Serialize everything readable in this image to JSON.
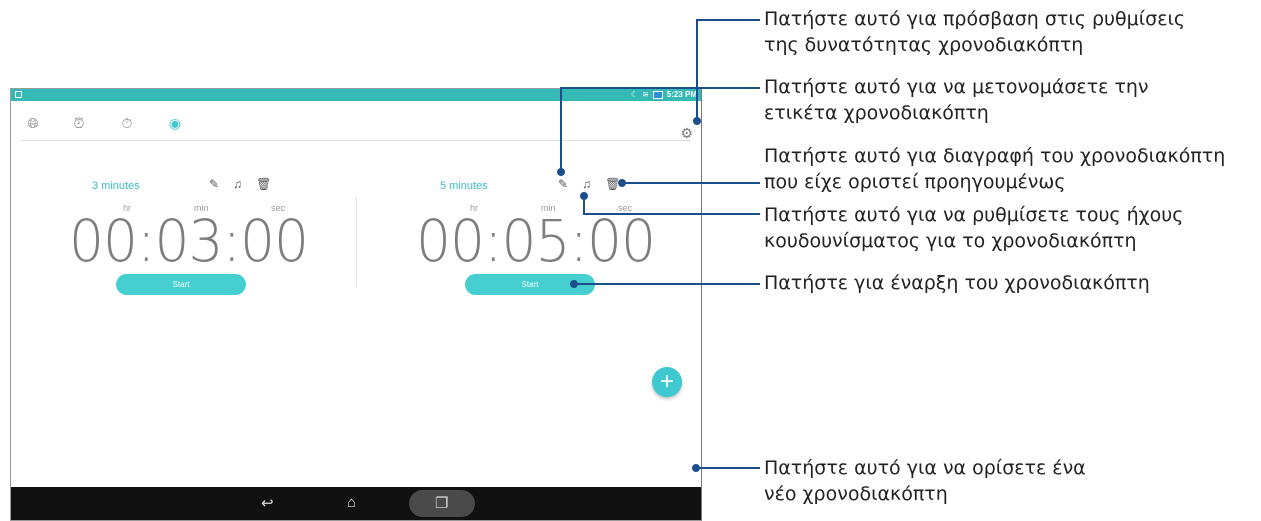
{
  "statusbar": {
    "time": "5:23 PM"
  },
  "tabs": [
    {
      "icon": "globe-icon"
    },
    {
      "icon": "alarm-icon"
    },
    {
      "icon": "stopwatch-icon"
    },
    {
      "icon": "timer-icon"
    }
  ],
  "timers": [
    {
      "label": "3 minutes",
      "hr_label": "hr",
      "min_label": "min",
      "sec_label": "sec",
      "display": "00:03:00",
      "start_label": "Start"
    },
    {
      "label": "5 minutes",
      "hr_label": "hr",
      "min_label": "min",
      "sec_label": "sec",
      "display": "00:05:00",
      "start_label": "Start"
    }
  ],
  "fab": {
    "icon": "plus-icon",
    "glyph": "+"
  },
  "callouts": {
    "settings": [
      "Πατήστε αυτό για πρόσβαση στις ρυθμίσεις",
      "της δυνατότητας χρονοδιακόπτη"
    ],
    "rename": [
      "Πατήστε αυτό για να μετονομάσετε την",
      "ετικέτα χρονοδιακόπτη"
    ],
    "delete": [
      "Πατήστε αυτό για διαγραφή του χρονοδιακόπτη",
      "που είχε οριστεί προηγουμένως"
    ],
    "sound": [
      "Πατήστε αυτό για να ρυθμίσετε τους ήχους",
      "κουδουνίσματος για το χρονοδιακόπτη"
    ],
    "start": [
      "Πατήστε για έναρξη του χρονοδιακόπτη"
    ],
    "add": [
      "Πατήστε αυτό για να ορίσετε ένα",
      "νέο χρονοδιακόπτη"
    ]
  },
  "colors": {
    "accent": "#3ec8cf",
    "statusbar": "#35b9b4",
    "callout_line": "#1a4f8c"
  }
}
